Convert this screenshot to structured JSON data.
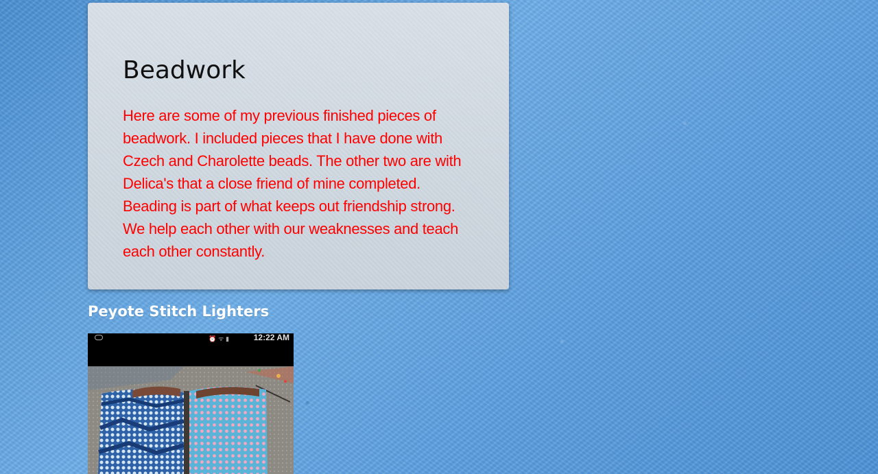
{
  "card": {
    "title": "Beadwork",
    "description": "Here are some of my previous finished pieces of beadwork. I included pieces that I have done with Czech and Charolette beads. The other two are with Delica's that a close friend of mine completed. Beading is part of what keeps out friendship strong. We help each other with our weaknesses and teach each other constantly."
  },
  "section": {
    "heading": "Peyote Stitch Lighters"
  },
  "photo": {
    "status_time": "12:22 AM",
    "status_icons": "⏰ ᯤ ▮"
  },
  "colors": {
    "text_red": "#ff0000",
    "heading_white": "#ffffff",
    "card_bg": "#d2dae2",
    "page_blue": "#5f9fd8"
  }
}
